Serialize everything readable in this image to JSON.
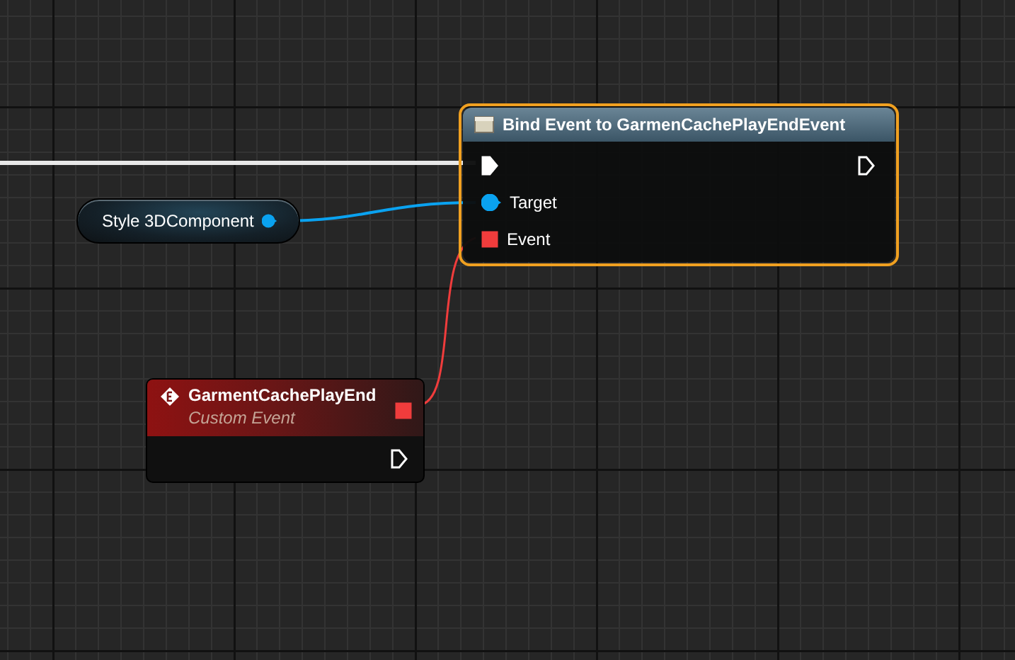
{
  "variable_node": {
    "label": "Style 3DComponent",
    "color": "#0aa2f0",
    "connected": true
  },
  "bind_node": {
    "title": "Bind Event to GarmenCachePlayEndEvent",
    "selected": true,
    "exec_in": {
      "connected": true
    },
    "exec_out": {
      "connected": false
    },
    "inputs": [
      {
        "kind": "object",
        "label": "Target",
        "color": "#0aa2f0",
        "connected": true
      },
      {
        "kind": "delegate",
        "label": "Event",
        "color": "#f03c3c",
        "connected": true
      }
    ]
  },
  "event_node": {
    "title": "GarmentCachePlayEnd",
    "subtitle": "Custom Event",
    "selected": false,
    "delegate_pin": {
      "color": "#f03c3c",
      "connected": true
    },
    "exec_out": {
      "connected": false
    }
  }
}
